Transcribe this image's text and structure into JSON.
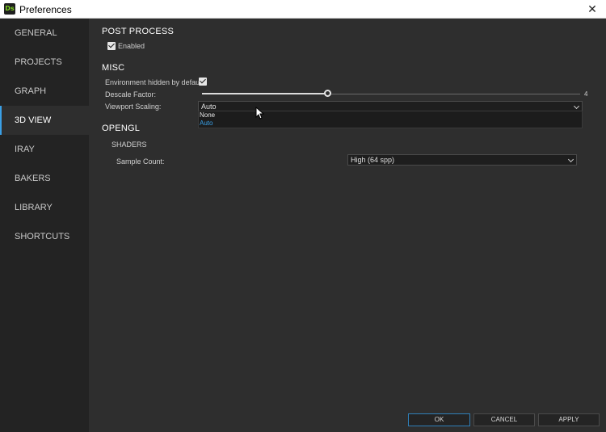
{
  "window": {
    "title": "Preferences",
    "app_icon_text": "Ds"
  },
  "sidebar": {
    "items": [
      {
        "label": "GENERAL"
      },
      {
        "label": "PROJECTS"
      },
      {
        "label": "GRAPH"
      },
      {
        "label": "3D VIEW"
      },
      {
        "label": "IRAY"
      },
      {
        "label": "BAKERS"
      },
      {
        "label": "LIBRARY"
      },
      {
        "label": "SHORTCUTS"
      }
    ],
    "active": "3D VIEW"
  },
  "post_process": {
    "heading": "POST PROCESS",
    "enabled_label": "Enabled",
    "enabled": true
  },
  "misc": {
    "heading": "MISC",
    "env_hidden_label": "Environment hidden by default:",
    "env_hidden": true,
    "descale_label": "Descale Factor:",
    "descale_value": "4",
    "descale_fraction": 0.33,
    "viewport_label": "Viewport Scaling:",
    "viewport_value": "Auto",
    "viewport_options": [
      "None",
      "Auto"
    ]
  },
  "opengl": {
    "heading": "OPENGL",
    "shaders_heading": "SHADERS",
    "sample_count_label": "Sample Count:",
    "sample_count_value": "High (64 spp)"
  },
  "buttons": {
    "ok": "OK",
    "cancel": "CANCEL",
    "apply": "APPLY"
  },
  "colors": {
    "accent": "#3aa0e6",
    "background": "#2e2e2e",
    "sidebar": "#232323"
  }
}
